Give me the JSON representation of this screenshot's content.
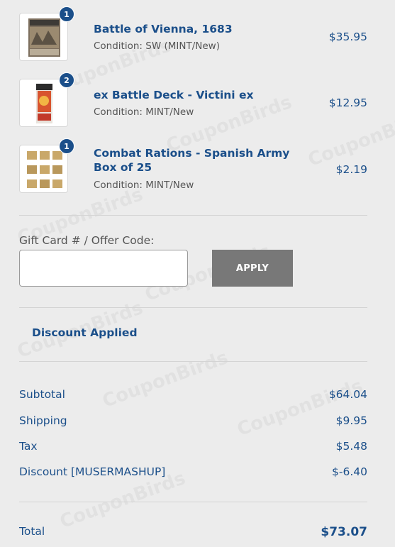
{
  "watermark_text": "CouponBirds",
  "items": [
    {
      "name": "Battle of Vienna, 1683",
      "condition": "Condition: SW (MINT/New)",
      "price": "$35.95",
      "qty": "1",
      "thumb": "boardgame-box-art"
    },
    {
      "name": "ex Battle Deck - Victini ex",
      "condition": "Condition: MINT/New",
      "price": "$12.95",
      "qty": "2",
      "thumb": "card-deck-box"
    },
    {
      "name": "Combat Rations - Spanish Army Box of 25",
      "condition": "Condition: MINT/New",
      "price": "$2.19",
      "qty": "1",
      "thumb": "ration-crates"
    }
  ],
  "gift": {
    "label": "Gift Card # / Offer Code:",
    "value": "",
    "apply_label": "APPLY"
  },
  "discount_applied": "Discount Applied",
  "summary": {
    "subtotal_label": "Subtotal",
    "subtotal": "$64.04",
    "shipping_label": "Shipping",
    "shipping": "$9.95",
    "tax_label": "Tax",
    "tax": "$5.48",
    "discount_label": "Discount [MUSERMASHUP]",
    "discount": "$-6.40",
    "total_label": "Total",
    "total": "$73.07"
  },
  "colors": {
    "accent": "#1b4f8a",
    "apply_bg": "#787878",
    "page_bg": "#ececec"
  }
}
